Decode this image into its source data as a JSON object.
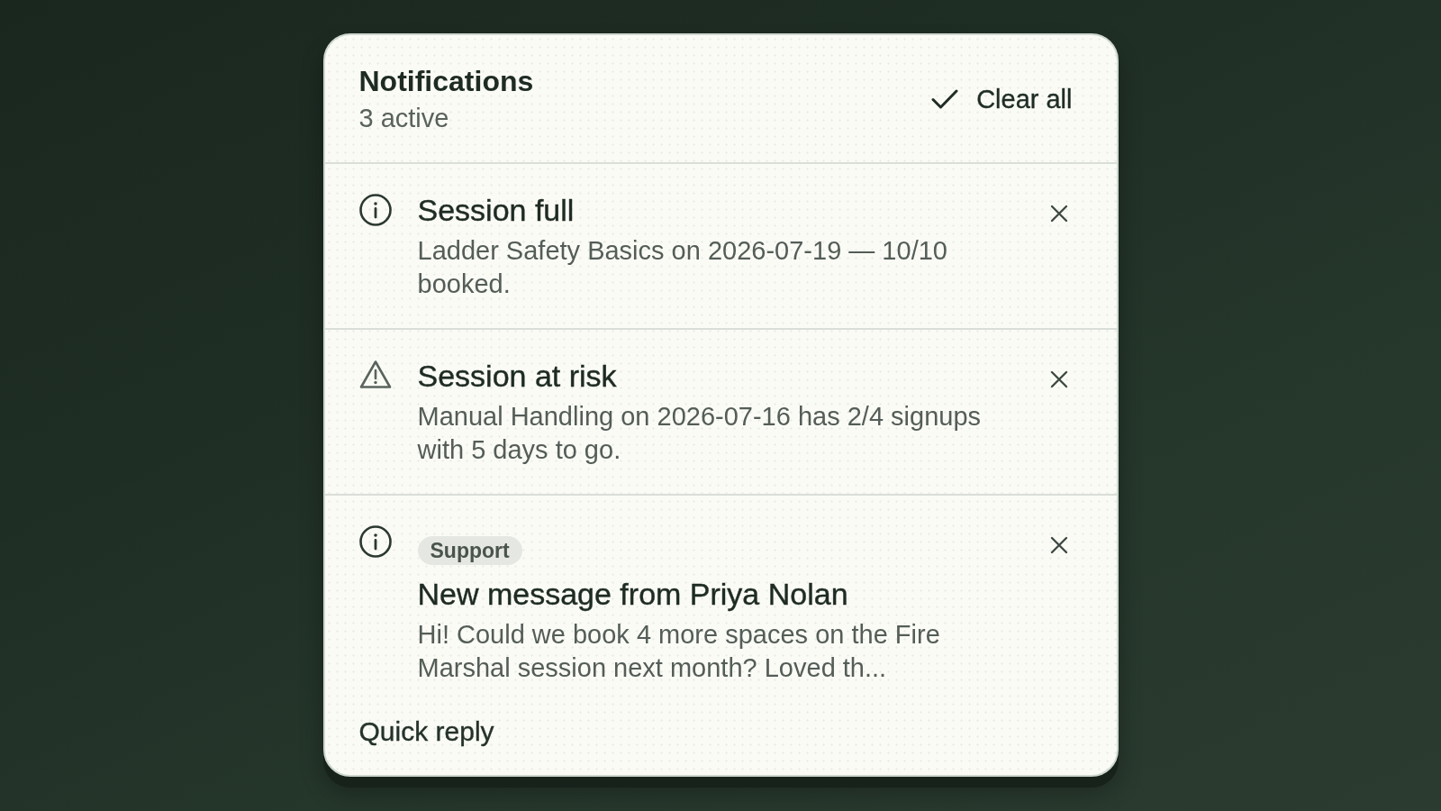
{
  "panel": {
    "title": "Notifications",
    "subtitle": "3 active",
    "clear_all": "Clear all"
  },
  "notifications": [
    {
      "kind": "info",
      "title": "Session full",
      "message": "Ladder Safety Basics on 2026-07-19 — 10/10 booked."
    },
    {
      "kind": "warning",
      "title": "Session at risk",
      "message": "Manual Handling on 2026-07-16 has 2/4 signups with 5 days to go."
    },
    {
      "kind": "info",
      "tag": "Support",
      "title": "New message from Priya Nolan",
      "message": "Hi! Could we book 4 more spaces on the Fire Marshal session next month? Loved th...",
      "action": "Quick reply"
    }
  ]
}
